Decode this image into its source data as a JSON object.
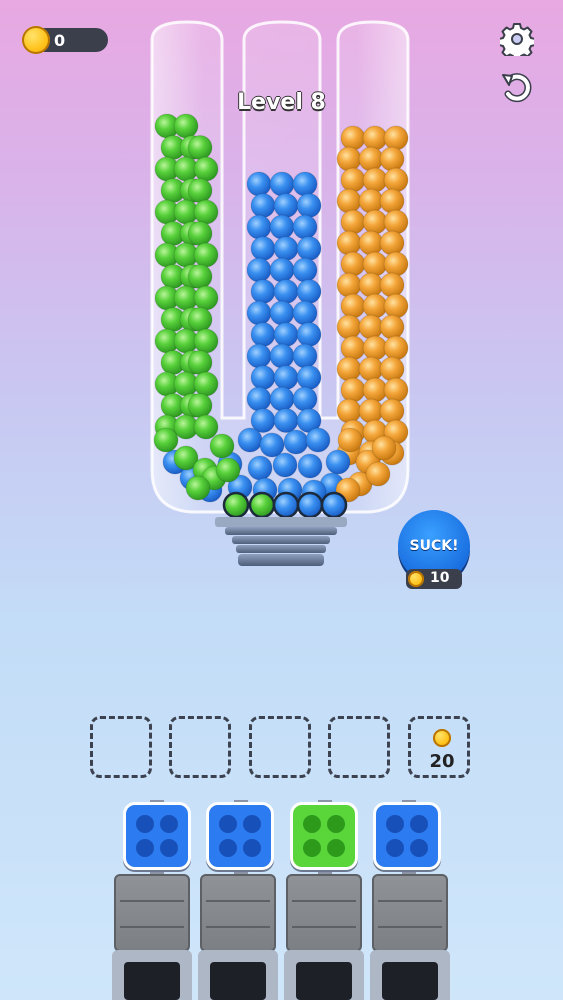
{
  "hud": {
    "coins": "0",
    "settings_icon": "gear-icon",
    "undo_icon": "undo-icon"
  },
  "level": {
    "label": "Level 8"
  },
  "tubes": [
    {
      "color": "green",
      "hex": "#4cc83a"
    },
    {
      "color": "blue",
      "hex": "#2f86ea"
    },
    {
      "color": "orange",
      "hex": "#f0a030"
    }
  ],
  "suck": {
    "label": "SUCK!",
    "cost": "10"
  },
  "slots": [
    {
      "state": "empty"
    },
    {
      "state": "empty"
    },
    {
      "state": "empty"
    },
    {
      "state": "empty"
    },
    {
      "state": "locked",
      "cost": "20"
    }
  ],
  "cups": [
    {
      "color": "blue"
    },
    {
      "color": "blue"
    },
    {
      "color": "green"
    },
    {
      "color": "blue"
    }
  ],
  "colors": {
    "blue": "#2d7bf0",
    "green": "#5ad63b",
    "orange": "#f0a030",
    "coin": "#ffc21a"
  }
}
